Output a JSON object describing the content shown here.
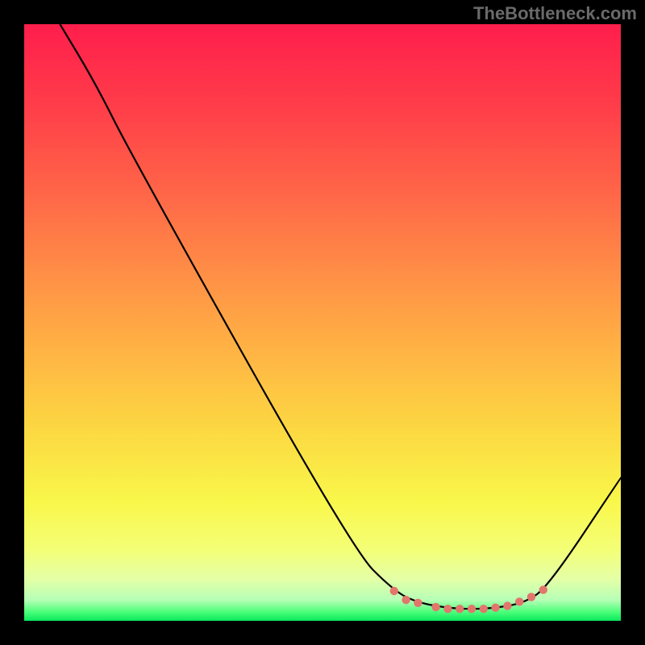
{
  "watermark": "TheBottleneck.com",
  "chart_data": {
    "type": "line",
    "title": "",
    "xlabel": "",
    "ylabel": "",
    "xlim": [
      0,
      100
    ],
    "ylim": [
      0,
      100
    ],
    "grid": false,
    "series": [
      {
        "name": "curve",
        "stroke": "#000000",
        "values": [
          {
            "x": 6,
            "y": 100
          },
          {
            "x": 12,
            "y": 90
          },
          {
            "x": 18,
            "y": 78
          },
          {
            "x": 55,
            "y": 12
          },
          {
            "x": 62,
            "y": 5
          },
          {
            "x": 66,
            "y": 3
          },
          {
            "x": 72,
            "y": 2
          },
          {
            "x": 78,
            "y": 2
          },
          {
            "x": 84,
            "y": 3
          },
          {
            "x": 88,
            "y": 6
          },
          {
            "x": 100,
            "y": 24
          }
        ]
      }
    ],
    "markers": {
      "name": "highlight-dots",
      "fill": "#e2766d",
      "points": [
        {
          "x": 62,
          "y": 5
        },
        {
          "x": 64,
          "y": 3.5
        },
        {
          "x": 66,
          "y": 3
        },
        {
          "x": 69,
          "y": 2.3
        },
        {
          "x": 71,
          "y": 2
        },
        {
          "x": 73,
          "y": 2
        },
        {
          "x": 75,
          "y": 2
        },
        {
          "x": 77,
          "y": 2
        },
        {
          "x": 79,
          "y": 2.2
        },
        {
          "x": 81,
          "y": 2.5
        },
        {
          "x": 83,
          "y": 3.2
        },
        {
          "x": 85,
          "y": 4
        },
        {
          "x": 87,
          "y": 5.2
        }
      ]
    },
    "gradient_stops": [
      {
        "offset": 0,
        "color": "#ff1e4c"
      },
      {
        "offset": 0.13,
        "color": "#ff3b49"
      },
      {
        "offset": 0.28,
        "color": "#ff6548"
      },
      {
        "offset": 0.42,
        "color": "#ff8f46"
      },
      {
        "offset": 0.55,
        "color": "#ffb444"
      },
      {
        "offset": 0.68,
        "color": "#fcd842"
      },
      {
        "offset": 0.8,
        "color": "#f9f74a"
      },
      {
        "offset": 0.88,
        "color": "#f4ff76"
      },
      {
        "offset": 0.93,
        "color": "#e4ffa6"
      },
      {
        "offset": 0.965,
        "color": "#b6ffb6"
      },
      {
        "offset": 0.985,
        "color": "#4cff7a"
      },
      {
        "offset": 1.0,
        "color": "#08e85b"
      }
    ]
  }
}
